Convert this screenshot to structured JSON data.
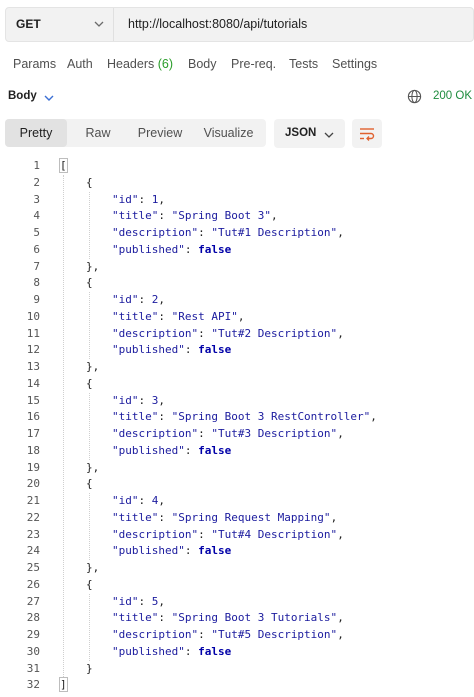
{
  "request": {
    "method": "GET",
    "url": "http://localhost:8080/api/tutorials"
  },
  "tabs": [
    {
      "label": "Params"
    },
    {
      "label": "Auth"
    },
    {
      "label": "Headers",
      "count": "(6)"
    },
    {
      "label": "Body"
    },
    {
      "label": "Pre-req."
    },
    {
      "label": "Tests"
    },
    {
      "label": "Settings"
    }
  ],
  "response": {
    "section_label": "Body",
    "status": "200 OK",
    "views": [
      "Pretty",
      "Raw",
      "Preview",
      "Visualize"
    ],
    "active_view": "Pretty",
    "format": "JSON"
  },
  "icons": {
    "method_dropdown": "chevron-down-icon",
    "body_dropdown": "chevron-down-icon",
    "network": "globe-icon",
    "format_dropdown": "chevron-down-icon",
    "wrap": "wrap-lines-icon"
  },
  "colors": {
    "status_ok": "#1e8c3e",
    "count": "#2a9d2a",
    "json_value": "#1b1b9e"
  },
  "code": {
    "tutorials": [
      {
        "id": 1,
        "title": "Spring Boot 3",
        "description": "Tut#1 Description",
        "published": "false"
      },
      {
        "id": 2,
        "title": "Rest API",
        "description": "Tut#2 Description",
        "published": "false"
      },
      {
        "id": 3,
        "title": "Spring Boot 3 RestController",
        "description": "Tut#3 Description",
        "published": "false"
      },
      {
        "id": 4,
        "title": "Spring Request Mapping",
        "description": "Tut#4 Description",
        "published": "false"
      },
      {
        "id": 5,
        "title": "Spring Boot 3 Tutorials",
        "description": "Tut#5 Description",
        "published": "false"
      }
    ]
  }
}
